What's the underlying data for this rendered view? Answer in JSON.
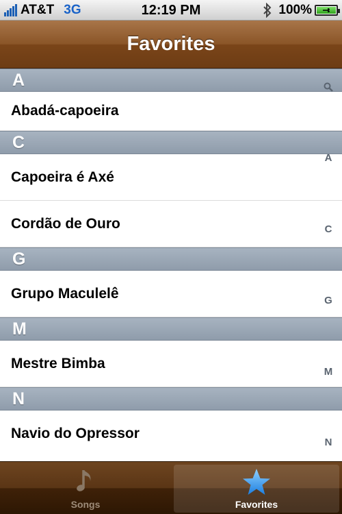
{
  "status_bar": {
    "carrier": "AT&T",
    "network": "3G",
    "time": "12:19 PM",
    "battery": "100%",
    "icons": [
      "signal-icon",
      "bluetooth-icon",
      "battery-charging-icon"
    ]
  },
  "nav": {
    "title": "Favorites"
  },
  "sections": [
    {
      "letter": "A",
      "rows": [
        "Abadá-capoeira"
      ]
    },
    {
      "letter": "C",
      "rows": [
        "Capoeira é Axé",
        "Cordão de Ouro"
      ]
    },
    {
      "letter": "G",
      "rows": [
        "Grupo Maculelê"
      ]
    },
    {
      "letter": "M",
      "rows": [
        "Mestre Bimba"
      ]
    },
    {
      "letter": "N",
      "rows": [
        "Navio do Opressor"
      ]
    }
  ],
  "index": [
    "A",
    "C",
    "G",
    "M",
    "N"
  ],
  "tabs": [
    {
      "label": "Songs",
      "icon": "music-note-icon",
      "selected": false
    },
    {
      "label": "Favorites",
      "icon": "star-icon",
      "selected": true
    }
  ],
  "colors": {
    "nav_bar": "#8a5527",
    "tab_bar": "#3f2108",
    "section_header": "#9aa6b3",
    "star": "#3fa0f0"
  }
}
